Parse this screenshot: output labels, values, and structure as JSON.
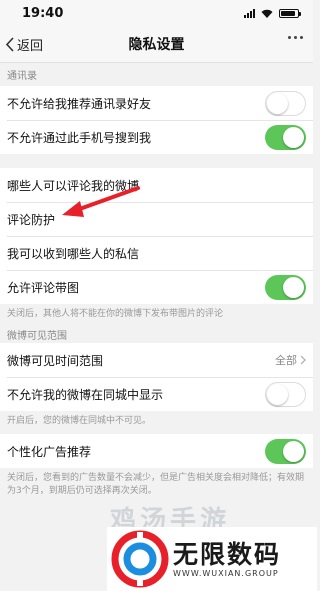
{
  "status": {
    "time": "19:40",
    "battery_level": 0.9
  },
  "nav": {
    "back_label": "返回",
    "title": "隐私设置"
  },
  "sections": {
    "contacts_header": "通讯录",
    "contacts_rows": [
      {
        "label": "不允许给我推荐通讯录好友",
        "toggle": false
      },
      {
        "label": "不允许通过此手机号搜到我",
        "toggle": true
      }
    ],
    "comments_rows": [
      {
        "label": "哪些人可以评论我的微博"
      },
      {
        "label": "评论防护"
      },
      {
        "label": "我可以收到哪些人的私信"
      },
      {
        "label": "允许评论带图",
        "toggle": true
      }
    ],
    "comments_note": "关闭后，其他人将不能在你的微博下发布带图片的评论",
    "visibility_header": "微博可见范围",
    "visibility_rows": [
      {
        "label": "微博可见时间范围",
        "value": "全部"
      },
      {
        "label": "不允许我的微博在同城中显示",
        "toggle": false
      }
    ],
    "visibility_note": "开启后，您的微博在同城中不可见。",
    "ads_rows": [
      {
        "label": "个性化广告推荐",
        "toggle": true
      }
    ],
    "ads_note": "关闭后，您看到的广告数量不会减少，但是广告相关度会相对降低；有效期为3个月，到期后仍可选择再次关闭。"
  },
  "watermark": {
    "top_text": "鸡汤手游",
    "title": "无限数码",
    "subtitle": "WWW.WUXIAN.GROUP"
  },
  "colors": {
    "toggle_on": "#5cc758",
    "annotation_arrow": "#e8202a",
    "background": "#f2f2f2"
  }
}
